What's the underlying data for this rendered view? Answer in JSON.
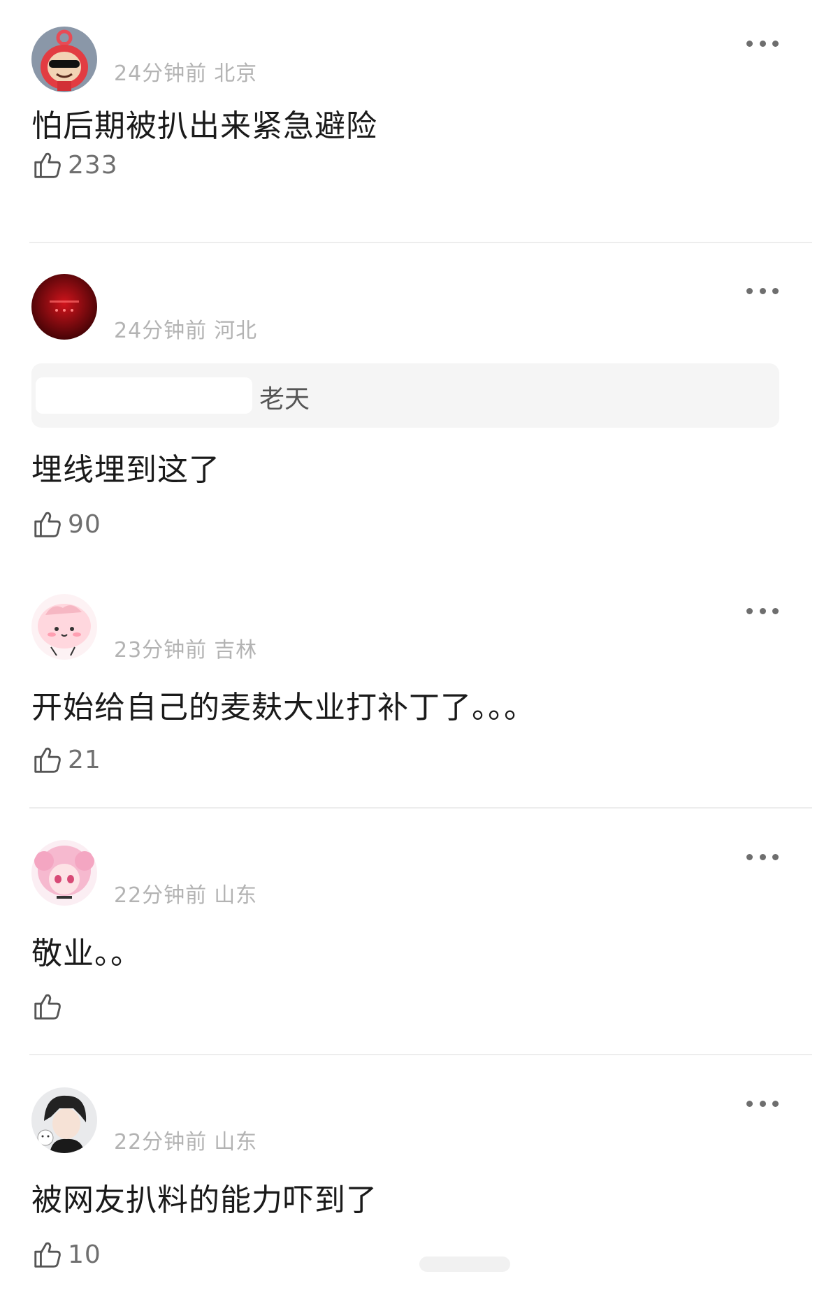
{
  "comments": [
    {
      "time": "24分钟前",
      "location": "北京",
      "text": "怕后期被扒出来紧急避险",
      "likes": "233",
      "avatar_icon": "red-teletubby-sunglasses-avatar"
    },
    {
      "time": "24分钟前",
      "location": "河北",
      "quote": "老天",
      "text": "埋线埋到这了",
      "likes": "90",
      "avatar_icon": "dark-red-stage-avatar"
    },
    {
      "time": "23分钟前",
      "location": "吉林",
      "text": "开始给自己的麦麸大业打补丁了。。。",
      "likes": "21",
      "avatar_icon": "pink-blob-avatar"
    },
    {
      "time": "22分钟前",
      "location": "山东",
      "text": "敬业。。",
      "likes": "",
      "avatar_icon": "pink-anime-girl-avatar"
    },
    {
      "time": "22分钟前",
      "location": "山东",
      "text": "被网友扒料的能力吓到了",
      "likes": "10",
      "avatar_icon": "anime-boy-cat-avatar"
    }
  ],
  "icons": {
    "like": "thumbs-up-icon",
    "more": "more-dots-icon"
  }
}
